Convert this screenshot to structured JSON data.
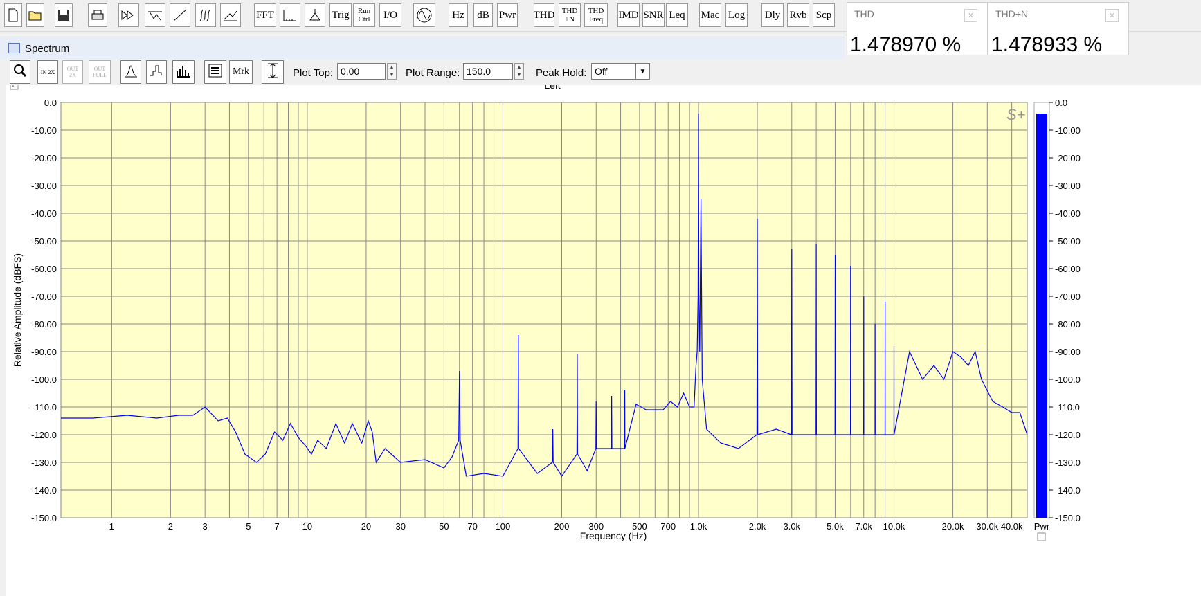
{
  "toolbar": {
    "buttons": [
      {
        "name": "new-file-button",
        "label": "",
        "icon": "new-file-icon"
      },
      {
        "name": "open-file-button",
        "label": "",
        "icon": "open-folder-icon"
      },
      {
        "name": "save-button",
        "label": "",
        "icon": "floppy-disk-icon"
      },
      {
        "name": "print-button",
        "label": "",
        "icon": "printer-icon"
      },
      {
        "name": "fast-forward-button",
        "label": "",
        "icon": "fast-forward-icon"
      },
      {
        "name": "filter-button",
        "label": "",
        "icon": "filter-icon"
      },
      {
        "name": "ramp-button",
        "label": "",
        "icon": "ramp-icon"
      },
      {
        "name": "waterfall-button",
        "label": "",
        "icon": "waterfall-icon"
      },
      {
        "name": "surface-button",
        "label": "",
        "icon": "surface-icon"
      },
      {
        "name": "fft-button",
        "label": "FFT"
      },
      {
        "name": "scale-button",
        "label": "",
        "icon": "scale-icon"
      },
      {
        "name": "probe-button",
        "label": "",
        "icon": "probe-icon"
      },
      {
        "name": "trig-button",
        "label": "Trig"
      },
      {
        "name": "run-ctrl-button",
        "label": "Run Ctrl"
      },
      {
        "name": "io-button",
        "label": "I/O"
      },
      {
        "name": "generator-button",
        "label": "",
        "icon": "sine-wave-icon"
      },
      {
        "name": "hz-button",
        "label": "Hz"
      },
      {
        "name": "db-button",
        "label": "dB"
      },
      {
        "name": "pwr-button",
        "label": "Pwr"
      },
      {
        "name": "thd-button",
        "label": "THD"
      },
      {
        "name": "thd-n-button",
        "label": "THD +N"
      },
      {
        "name": "thd-freq-button",
        "label": "THD Freq"
      },
      {
        "name": "imd-button",
        "label": "IMD"
      },
      {
        "name": "snr-button",
        "label": "SNR"
      },
      {
        "name": "leq-button",
        "label": "Leq"
      },
      {
        "name": "mac-button",
        "label": "Mac"
      },
      {
        "name": "log-button",
        "label": "Log"
      },
      {
        "name": "dly-button",
        "label": "Dly"
      },
      {
        "name": "rvb-button",
        "label": "Rvb"
      },
      {
        "name": "scp-button",
        "label": "Scp"
      }
    ]
  },
  "meters": [
    {
      "label": "THD",
      "value": "1.478970 %"
    },
    {
      "label": "THD+N",
      "value": "1.478933 %"
    }
  ],
  "window": {
    "title": "Spectrum"
  },
  "plot_toolbar": {
    "zoom_buttons": [
      {
        "name": "zoom-button",
        "label": "",
        "icon": "magnifier-icon"
      },
      {
        "name": "zoom-in-2x-button",
        "label": "IN 2X"
      },
      {
        "name": "zoom-out-2x-button",
        "label": "OUT 2X"
      },
      {
        "name": "zoom-out-full-button",
        "label": "OUT FULL"
      },
      {
        "name": "line-mode-button",
        "label": "",
        "icon": "line-plot-icon"
      },
      {
        "name": "step-mode-button",
        "label": "",
        "icon": "step-plot-icon"
      },
      {
        "name": "bar-mode-button",
        "label": "",
        "icon": "bar-plot-icon"
      },
      {
        "name": "settings-button",
        "label": "",
        "icon": "list-icon"
      },
      {
        "name": "marker-button",
        "label": "Mrk"
      },
      {
        "name": "autoscale-button",
        "label": "",
        "icon": "autoscale-icon"
      }
    ],
    "plot_top_label": "Plot Top:",
    "plot_top_value": "0.00",
    "plot_range_label": "Plot Range:",
    "plot_range_value": "150.0",
    "peak_hold_label": "Peak Hold:",
    "peak_hold_value": "Off"
  },
  "chart_data": {
    "type": "line",
    "title": "Left",
    "xlabel": "Frequency (Hz)",
    "ylabel": "Relative Amplitude (dBFS)",
    "xscale": "log",
    "xlim": [
      0.55,
      48000
    ],
    "ylim": [
      -150,
      0
    ],
    "yticks": [
      0,
      -10,
      -20,
      -30,
      -40,
      -50,
      -60,
      -70,
      -80,
      -90,
      -100,
      -110,
      -120,
      -130,
      -140,
      -150
    ],
    "ytick_labels": [
      "0.0",
      "-10.00",
      "-20.00",
      "-30.00",
      "-40.00",
      "-50.00",
      "-60.00",
      "-70.00",
      "-80.00",
      "-90.00",
      "-100.0",
      "-110.0",
      "-120.0",
      "-130.0",
      "-140.0",
      "-150.0"
    ],
    "xtick_labels": [
      {
        "f": 1,
        "label": "1"
      },
      {
        "f": 2,
        "label": "2"
      },
      {
        "f": 3,
        "label": "3"
      },
      {
        "f": 5,
        "label": "5"
      },
      {
        "f": 7,
        "label": "7"
      },
      {
        "f": 10,
        "label": "10"
      },
      {
        "f": 20,
        "label": "20"
      },
      {
        "f": 30,
        "label": "30"
      },
      {
        "f": 50,
        "label": "50"
      },
      {
        "f": 70,
        "label": "70"
      },
      {
        "f": 100,
        "label": "100"
      },
      {
        "f": 200,
        "label": "200"
      },
      {
        "f": 300,
        "label": "300"
      },
      {
        "f": 500,
        "label": "500"
      },
      {
        "f": 700,
        "label": "700"
      },
      {
        "f": 1000,
        "label": "1.0k"
      },
      {
        "f": 2000,
        "label": "2.0k"
      },
      {
        "f": 3000,
        "label": "3.0k"
      },
      {
        "f": 5000,
        "label": "5.0k"
      },
      {
        "f": 7000,
        "label": "7.0k"
      },
      {
        "f": 10000,
        "label": "10.0k"
      },
      {
        "f": 20000,
        "label": "20.0k"
      },
      {
        "f": 30000,
        "label": "30.0k"
      },
      {
        "f": 40000,
        "label": "40.0k"
      }
    ],
    "grid": true,
    "background_color": "#ffffcc",
    "line_color": "#0000ff",
    "series": [
      {
        "values": [
          [
            0.55,
            -114
          ],
          [
            0.8,
            -114
          ],
          [
            1.2,
            -113
          ],
          [
            1.7,
            -114
          ],
          [
            2.2,
            -113
          ],
          [
            2.6,
            -113
          ],
          [
            3.0,
            -110
          ],
          [
            3.5,
            -115
          ],
          [
            3.9,
            -114
          ],
          [
            4.3,
            -119
          ],
          [
            4.8,
            -127
          ],
          [
            5.5,
            -130
          ],
          [
            6.1,
            -127
          ],
          [
            6.8,
            -119
          ],
          [
            7.5,
            -122
          ],
          [
            8.2,
            -116
          ],
          [
            9.0,
            -121
          ],
          [
            9.8,
            -124
          ],
          [
            10.5,
            -127
          ],
          [
            11.3,
            -122
          ],
          [
            12.5,
            -125
          ],
          [
            14,
            -116
          ],
          [
            15.5,
            -123
          ],
          [
            17,
            -116
          ],
          [
            19,
            -123
          ],
          [
            20.5,
            -115
          ],
          [
            21.5,
            -119
          ],
          [
            22.5,
            -130
          ],
          [
            25,
            -125
          ],
          [
            30,
            -130
          ],
          [
            40,
            -129
          ],
          [
            50,
            -132
          ],
          [
            55,
            -128
          ],
          [
            59.5,
            -122
          ],
          [
            60,
            -97
          ],
          [
            60.5,
            -122
          ],
          [
            65,
            -135
          ],
          [
            80,
            -134
          ],
          [
            100,
            -135
          ],
          [
            119.5,
            -125
          ],
          [
            120,
            -84
          ],
          [
            120.5,
            -125
          ],
          [
            150,
            -134
          ],
          [
            179,
            -130
          ],
          [
            180,
            -118
          ],
          [
            181,
            -130
          ],
          [
            200,
            -135
          ],
          [
            239,
            -127
          ],
          [
            240,
            -91
          ],
          [
            241,
            -127
          ],
          [
            270,
            -133
          ],
          [
            299,
            -125
          ],
          [
            300,
            -108
          ],
          [
            301,
            -125
          ],
          [
            359,
            -125
          ],
          [
            360,
            -106
          ],
          [
            361,
            -125
          ],
          [
            419,
            -125
          ],
          [
            420,
            -104
          ],
          [
            421,
            -125
          ],
          [
            480,
            -109
          ],
          [
            540,
            -111
          ],
          [
            600,
            -111
          ],
          [
            660,
            -111
          ],
          [
            720,
            -108
          ],
          [
            780,
            -110
          ],
          [
            840,
            -105
          ],
          [
            900,
            -110
          ],
          [
            950,
            -110
          ],
          [
            970,
            -96
          ],
          [
            985,
            -90
          ],
          [
            995,
            -70
          ],
          [
            1000,
            -4
          ],
          [
            1005,
            -70
          ],
          [
            1015,
            -90
          ],
          [
            1030,
            -35
          ],
          [
            1045,
            -100
          ],
          [
            1100,
            -118
          ],
          [
            1300,
            -123
          ],
          [
            1600,
            -125
          ],
          [
            1990,
            -120
          ],
          [
            2000,
            -42
          ],
          [
            2010,
            -120
          ],
          [
            2500,
            -118
          ],
          [
            2990,
            -120
          ],
          [
            3000,
            -53
          ],
          [
            3010,
            -120
          ],
          [
            3500,
            -120
          ],
          [
            3990,
            -120
          ],
          [
            4000,
            -51
          ],
          [
            4010,
            -120
          ],
          [
            4500,
            -120
          ],
          [
            4990,
            -120
          ],
          [
            5000,
            -55
          ],
          [
            5010,
            -120
          ],
          [
            5990,
            -120
          ],
          [
            6000,
            -59
          ],
          [
            6010,
            -120
          ],
          [
            6990,
            -120
          ],
          [
            7000,
            -70
          ],
          [
            7010,
            -120
          ],
          [
            7990,
            -120
          ],
          [
            8000,
            -80
          ],
          [
            8010,
            -120
          ],
          [
            8990,
            -120
          ],
          [
            9000,
            -72
          ],
          [
            9010,
            -120
          ],
          [
            9990,
            -120
          ],
          [
            10000,
            -88
          ],
          [
            10010,
            -120
          ],
          [
            12000,
            -90
          ],
          [
            14000,
            -100
          ],
          [
            16000,
            -95
          ],
          [
            18000,
            -100
          ],
          [
            20000,
            -90
          ],
          [
            22000,
            -92
          ],
          [
            24000,
            -95
          ],
          [
            26000,
            -90
          ],
          [
            28000,
            -100
          ],
          [
            32000,
            -108
          ],
          [
            36000,
            -110
          ],
          [
            40000,
            -112
          ],
          [
            44000,
            -112
          ],
          [
            48000,
            -120
          ]
        ]
      }
    ],
    "color_bar": {
      "label": "Pwr",
      "level_db": -4,
      "color": "#0000ff"
    }
  }
}
